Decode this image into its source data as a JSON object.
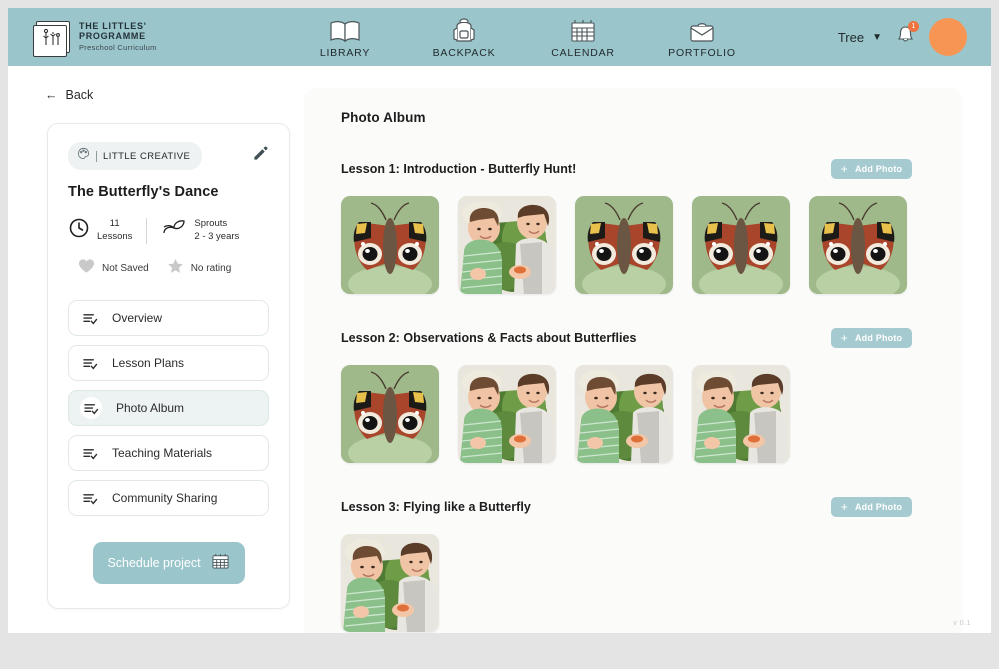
{
  "brand": {
    "line1": "The Littles'",
    "line2": "Programme",
    "subtitle": "Preschool Curriculum",
    "logo_icon": "book-plants-icon"
  },
  "header": {
    "nav": [
      {
        "label": "LIBRARY",
        "icon": "open-book-icon"
      },
      {
        "label": "BACKPACK",
        "icon": "backpack-icon"
      },
      {
        "label": "CALENDAR",
        "icon": "calendar-icon"
      },
      {
        "label": "PORTFOLIO",
        "icon": "briefcase-icon"
      }
    ],
    "user_name": "Tree",
    "chevron_icon": "chevron-down-icon",
    "bell_icon": "bell-icon",
    "notification_count": "1",
    "avatar_icon": "avatar",
    "teal": "#9ac5cb",
    "accent_orange": "#f79555"
  },
  "sidebar": {
    "back_label": "Back",
    "back_icon": "arrow-left-icon",
    "category_badge": "LITTLE CREATIVE",
    "category_icon": "palette-icon",
    "edit_icon": "pencil-icon",
    "project_title": "The Butterfly's Dance",
    "meta": {
      "lessons_count": "11",
      "lessons_label": "Lessons",
      "lessons_icon": "clock-icon",
      "age_group": "Sprouts",
      "age_range": "2 - 3 years",
      "age_icon": "sprout-icon",
      "saved_label": "Not Saved",
      "saved_icon": "heart-icon",
      "rating_label": "No rating",
      "rating_icon": "star-icon"
    },
    "items": [
      {
        "label": "Overview",
        "icon": "list-check-icon",
        "active": false
      },
      {
        "label": "Lesson Plans",
        "icon": "list-check-icon",
        "active": false
      },
      {
        "label": "Photo Album",
        "icon": "list-check-icon",
        "active": true
      },
      {
        "label": "Teaching Materials",
        "icon": "list-check-icon",
        "active": false
      },
      {
        "label": "Community Sharing",
        "icon": "list-check-icon",
        "active": false
      }
    ],
    "schedule_label": "Schedule project",
    "schedule_icon": "calendar-icon"
  },
  "main": {
    "panel_title": "Photo Album",
    "add_photo_label": "Add Photo",
    "add_photo_icon": "plus-icon",
    "lessons": [
      {
        "title": "Lesson 1: Introduction - Butterfly Hunt!",
        "photos": [
          "butterfly",
          "children",
          "butterfly",
          "butterfly",
          "butterfly"
        ]
      },
      {
        "title": "Lesson 2: Observations & Facts about Butterflies",
        "photos": [
          "butterfly",
          "children",
          "children",
          "children"
        ]
      },
      {
        "title": "Lesson 3: Flying like a Butterfly",
        "photos": [
          "children"
        ]
      }
    ]
  },
  "footer": {
    "version": "v 0.1"
  }
}
